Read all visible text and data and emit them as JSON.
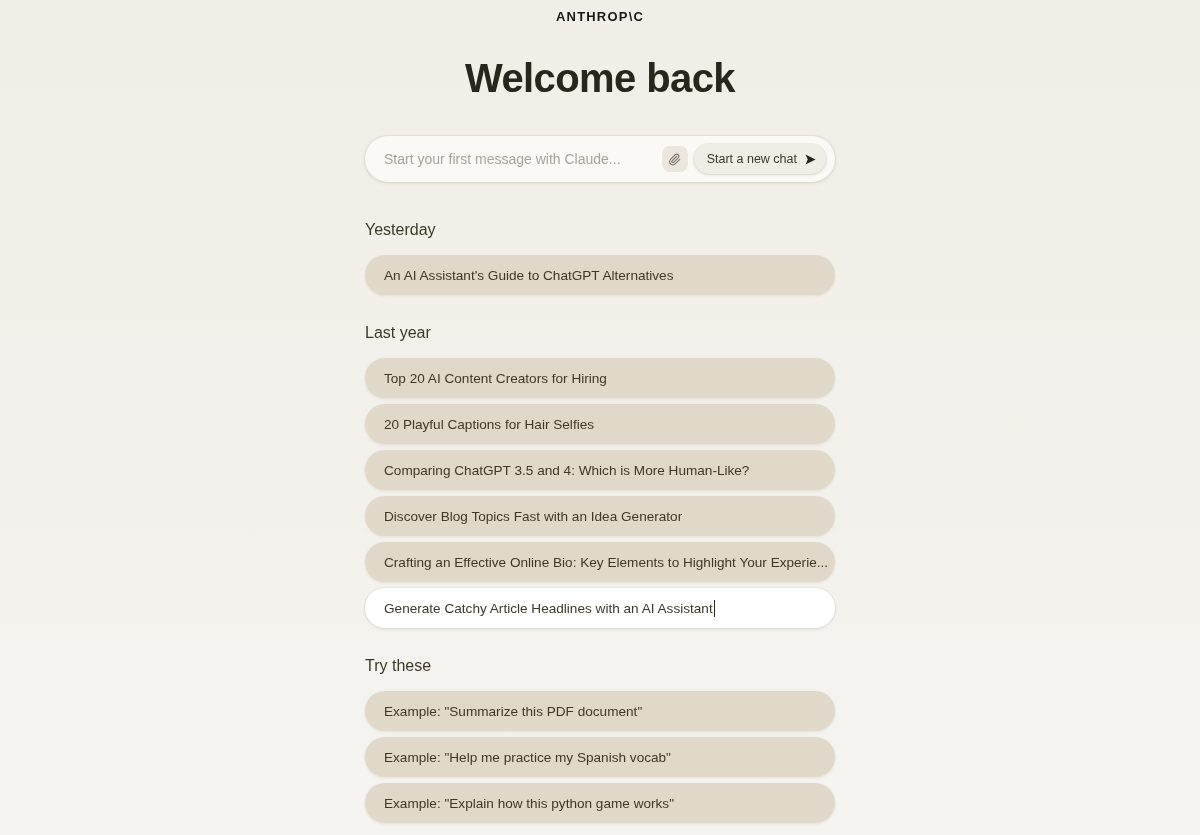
{
  "logo": {
    "text": "ANTHROP\\C"
  },
  "heading": "Welcome back",
  "composer": {
    "placeholder": "Start your first message with Claude...",
    "send_button_label": "Start a new chat"
  },
  "sections": [
    {
      "title": "Yesterday",
      "items": [
        {
          "title": "An AI Assistant's Guide to ChatGPT Alternatives",
          "editing": false
        }
      ]
    },
    {
      "title": "Last year",
      "items": [
        {
          "title": "Top 20 AI Content Creators for Hiring",
          "editing": false
        },
        {
          "title": "20 Playful Captions for Hair Selfies",
          "editing": false
        },
        {
          "title": "Comparing ChatGPT 3.5 and 4: Which is More Human-Like?",
          "editing": false
        },
        {
          "title": "Discover Blog Topics Fast with an Idea Generator",
          "editing": false
        },
        {
          "title": "Crafting an Effective Online Bio: Key Elements to Highlight Your Experie...",
          "editing": false
        },
        {
          "title": "Generate Catchy Article Headlines with an AI Assistant",
          "editing": true
        }
      ]
    }
  ],
  "suggestions": {
    "title": "Try these",
    "items": [
      "Example: \"Summarize this PDF document\"",
      "Example: \"Help me practice my Spanish vocab\"",
      "Example: \"Explain how this python game works\""
    ]
  }
}
